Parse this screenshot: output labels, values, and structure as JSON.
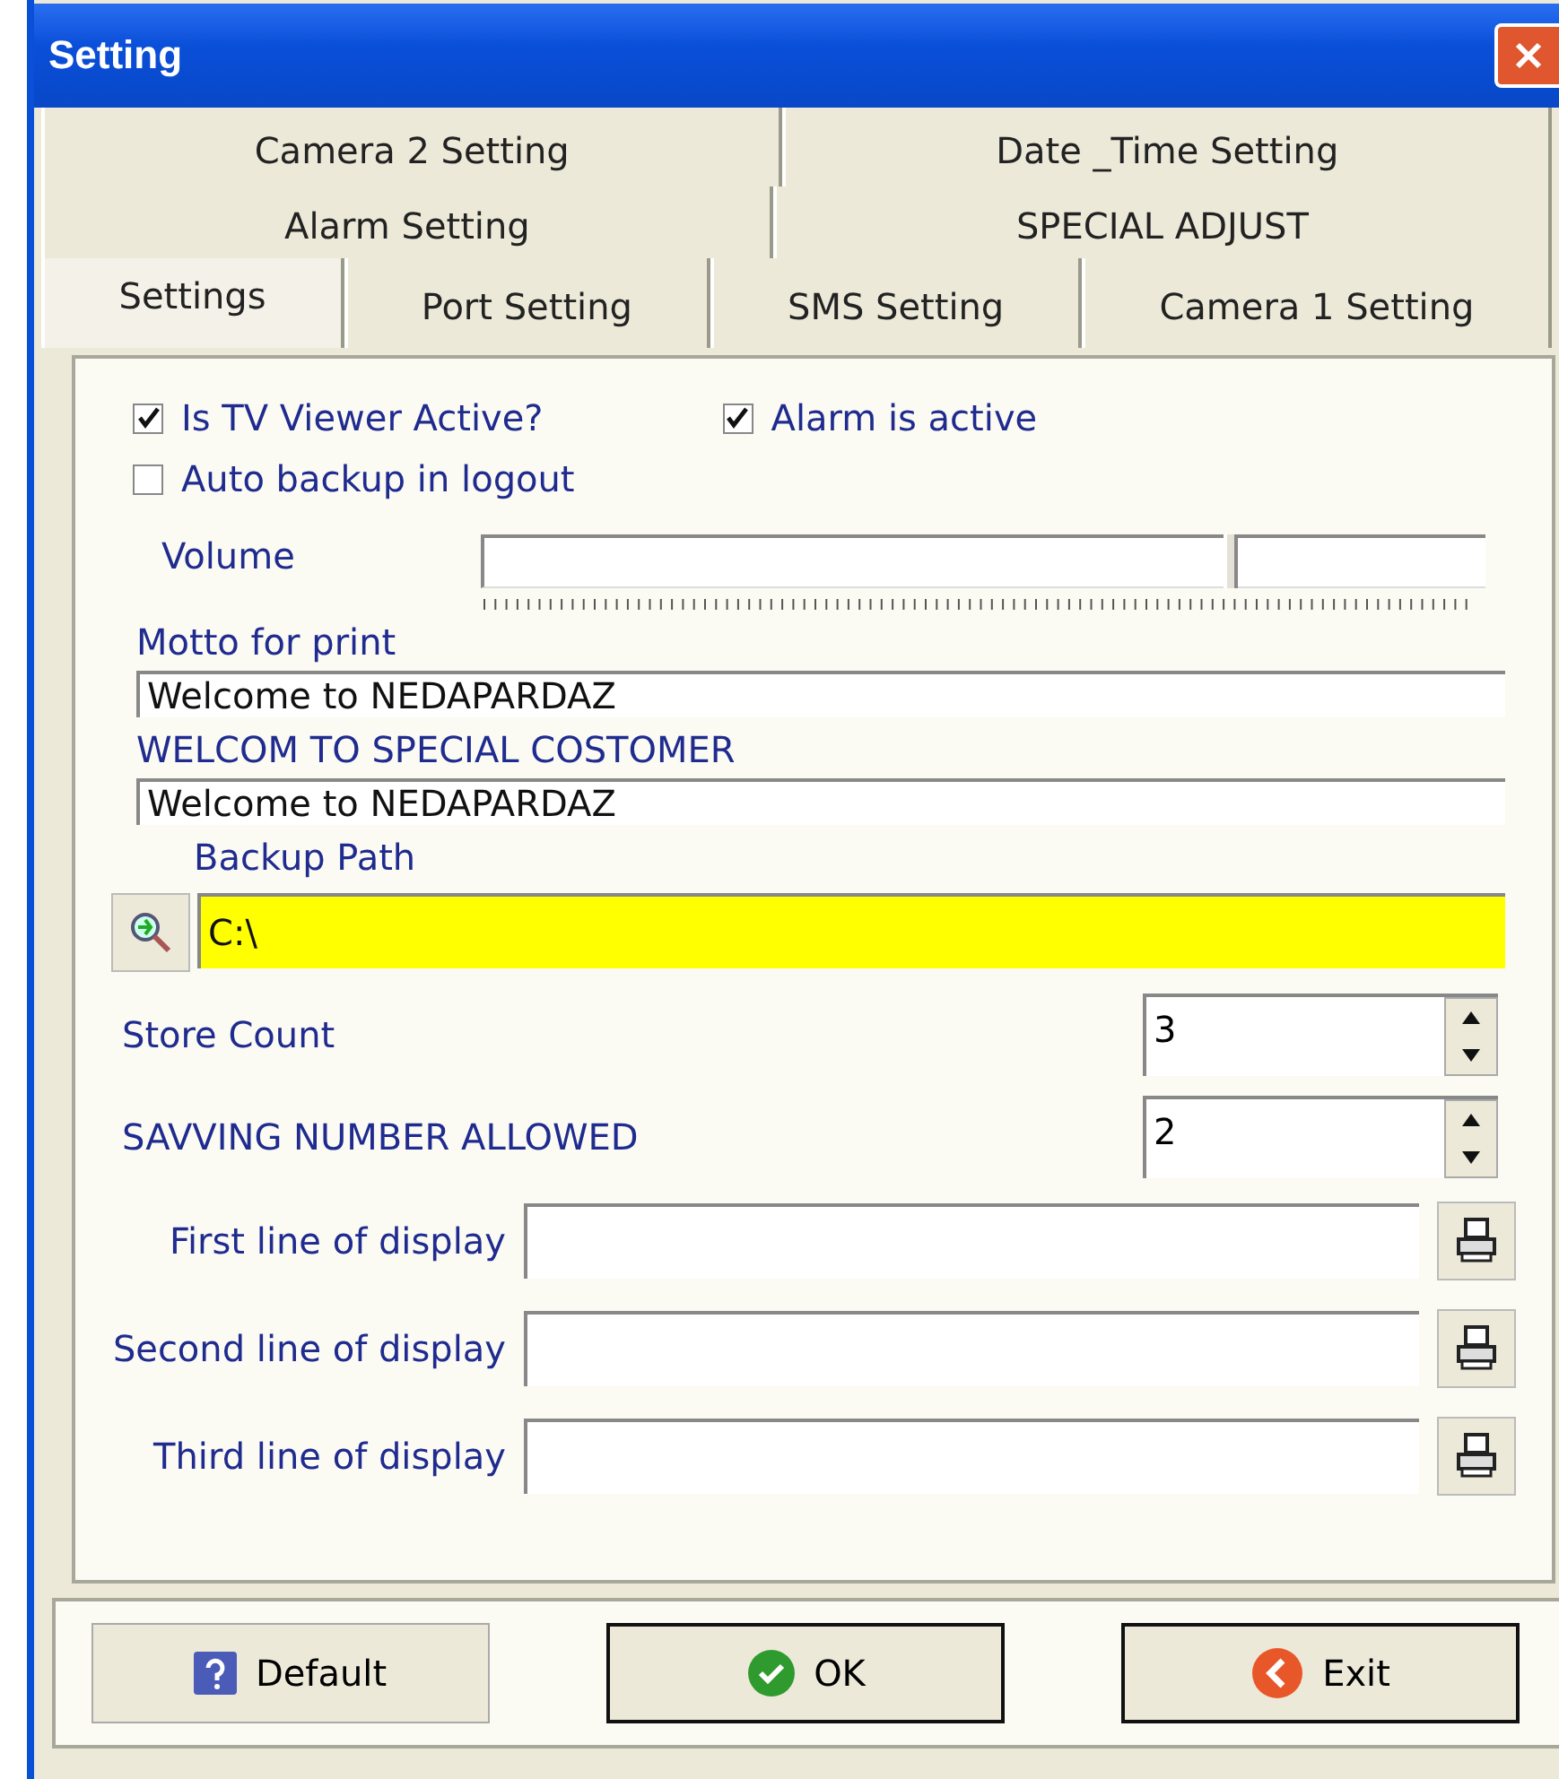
{
  "window": {
    "title": "Setting"
  },
  "tab_rows": [
    [
      {
        "label": "Camera 2 Setting",
        "selected": false
      },
      {
        "label": "Date _Time Setting",
        "selected": false
      }
    ],
    [
      {
        "label": "Alarm Setting",
        "selected": false
      },
      {
        "label": "SPECIAL ADJUST",
        "selected": false
      }
    ],
    [
      {
        "label": "Settings",
        "selected": true
      },
      {
        "label": "Port Setting",
        "selected": false
      },
      {
        "label": "SMS Setting",
        "selected": false
      },
      {
        "label": "Camera 1 Setting",
        "selected": false
      }
    ]
  ],
  "checkboxes": [
    {
      "label": "Is TV Viewer Active?",
      "checked": true
    },
    {
      "label": "Alarm is active",
      "checked": true
    },
    {
      "label": "Auto backup in logout",
      "checked": false
    }
  ],
  "volume": {
    "label": "Volume",
    "level": 0.745
  },
  "motto": {
    "label": "Motto for print",
    "value": "Welcome to NEDAPARDAZ"
  },
  "special": {
    "label": "WELCOM TO SPECIAL COSTOMER",
    "value": "Welcome to NEDAPARDAZ"
  },
  "backup": {
    "label": "Backup Path",
    "value": "C:\\"
  },
  "spinners": [
    {
      "label": "Store Count",
      "value": "3"
    },
    {
      "label": "SAVVING NUMBER ALLOWED",
      "value": "2"
    }
  ],
  "display_lines": [
    {
      "label": "First line of display"
    },
    {
      "label": "Second line of display"
    },
    {
      "label": "Third line of display"
    }
  ],
  "buttons": [
    {
      "label": "Default",
      "kind": "help"
    },
    {
      "label": "OK",
      "kind": "ok"
    },
    {
      "label": "Exit",
      "kind": "exit"
    }
  ]
}
